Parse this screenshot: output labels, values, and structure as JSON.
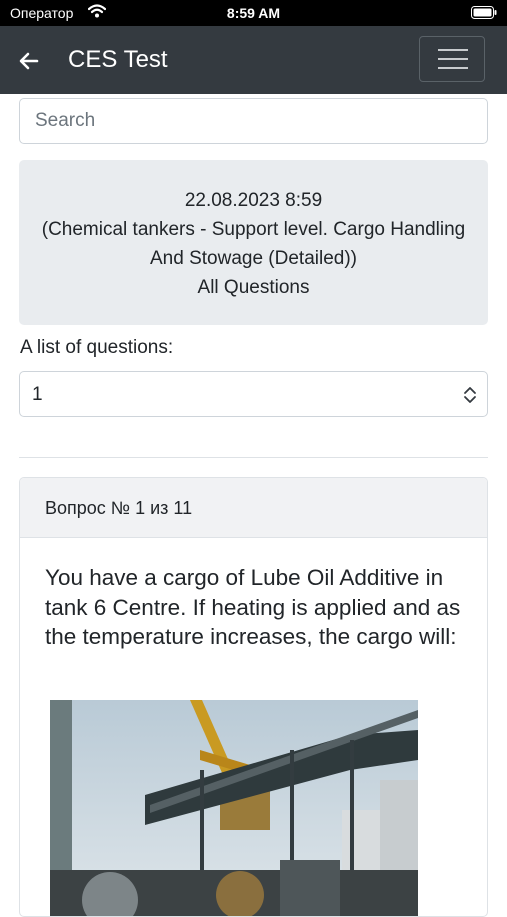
{
  "status_bar": {
    "carrier": "Оператор",
    "time": "8:59 AM"
  },
  "navbar": {
    "title": "CES Test",
    "back_icon": "arrow-left-icon",
    "menu_icon": "hamburger-menu-icon"
  },
  "search": {
    "placeholder": "Search",
    "value": ""
  },
  "info": {
    "datetime": "22.08.2023 8:59",
    "course": "(Chemical tankers - Support level. Cargo Handling And Stowage (Detailed))",
    "scope": "All Questions"
  },
  "question_list": {
    "label": "A list of questions:",
    "selected": "1"
  },
  "question_card": {
    "header": "Вопрос № 1 из 11",
    "text": "You have a cargo of Lube Oil Additive in tank 6 Centre. If heating is applied and as the temperature increases, the cargo will:",
    "image": "ship-deck-photo"
  },
  "colors": {
    "navbar": "#343a40",
    "info_bg": "#e9ecef",
    "status_bar": "#000000"
  }
}
